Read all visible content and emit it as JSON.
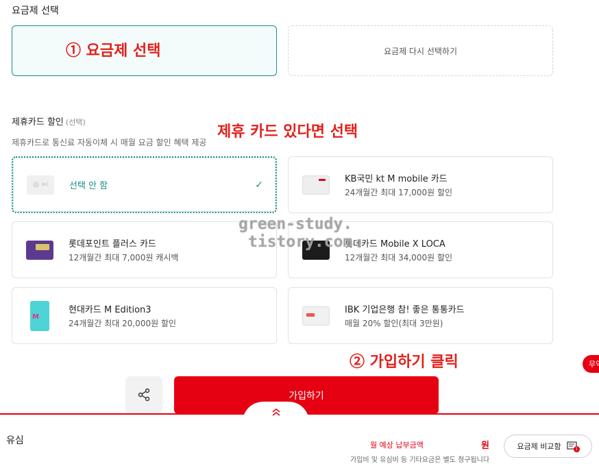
{
  "plan": {
    "section_title": "요금제 선택",
    "reselect_label": "요금제 다시 선택하기"
  },
  "annotations": {
    "step1": "① 요금제 선택",
    "card_hint": "제휴 카드 있다면 선택",
    "step2": "② 가입하기 클릭"
  },
  "partner_card": {
    "title": "제휴카드 할인",
    "optional": "(선택)",
    "subtitle": "제휴카드로 통신료 자동이체 시 매월 요금 할인 혜택 제공",
    "cards": [
      {
        "name": "선택 안 함",
        "desc": "",
        "thumb": "no-card-icon",
        "selected": true
      },
      {
        "name": "KB국민 kt M mobile 카드",
        "desc": "24개월간 최대 17,000원 할인",
        "thumb": "kb-card",
        "selected": false
      },
      {
        "name": "롯데포인트 플러스 카드",
        "desc": "12개월간 최대 7,000원 캐시백",
        "thumb": "lotte-point-card",
        "selected": false
      },
      {
        "name": "롯데카드 Mobile X LOCA",
        "desc": "12개월간 최대 34,000원 할인",
        "thumb": "lotte-loca-card",
        "selected": false
      },
      {
        "name": "현대카드 M Edition3",
        "desc": "24개월간 최대 20,000원 할인",
        "thumb": "hyundai-card",
        "selected": false
      },
      {
        "name": "IBK 기업은행 참! 좋은 통통카드",
        "desc": "매월 20% 할인(최대 3만원)",
        "thumb": "ibk-card",
        "selected": false
      }
    ],
    "no_card_tag": "NO"
  },
  "actions": {
    "join_label": "가입하기"
  },
  "bottom": {
    "usim_label": "유심",
    "pay_label": "월 예상 납부금액",
    "won": "원",
    "note": "가입비 및 유심비 등 기타요금은 별도 청구됩니다",
    "compare_label": "요금제 비교함",
    "compare_count": "1"
  },
  "side_badge": "무약",
  "watermark": [
    "green-study.",
    "tistory.com"
  ],
  "colors": {
    "accent": "#e50012",
    "teal": "#1a8c8a"
  }
}
